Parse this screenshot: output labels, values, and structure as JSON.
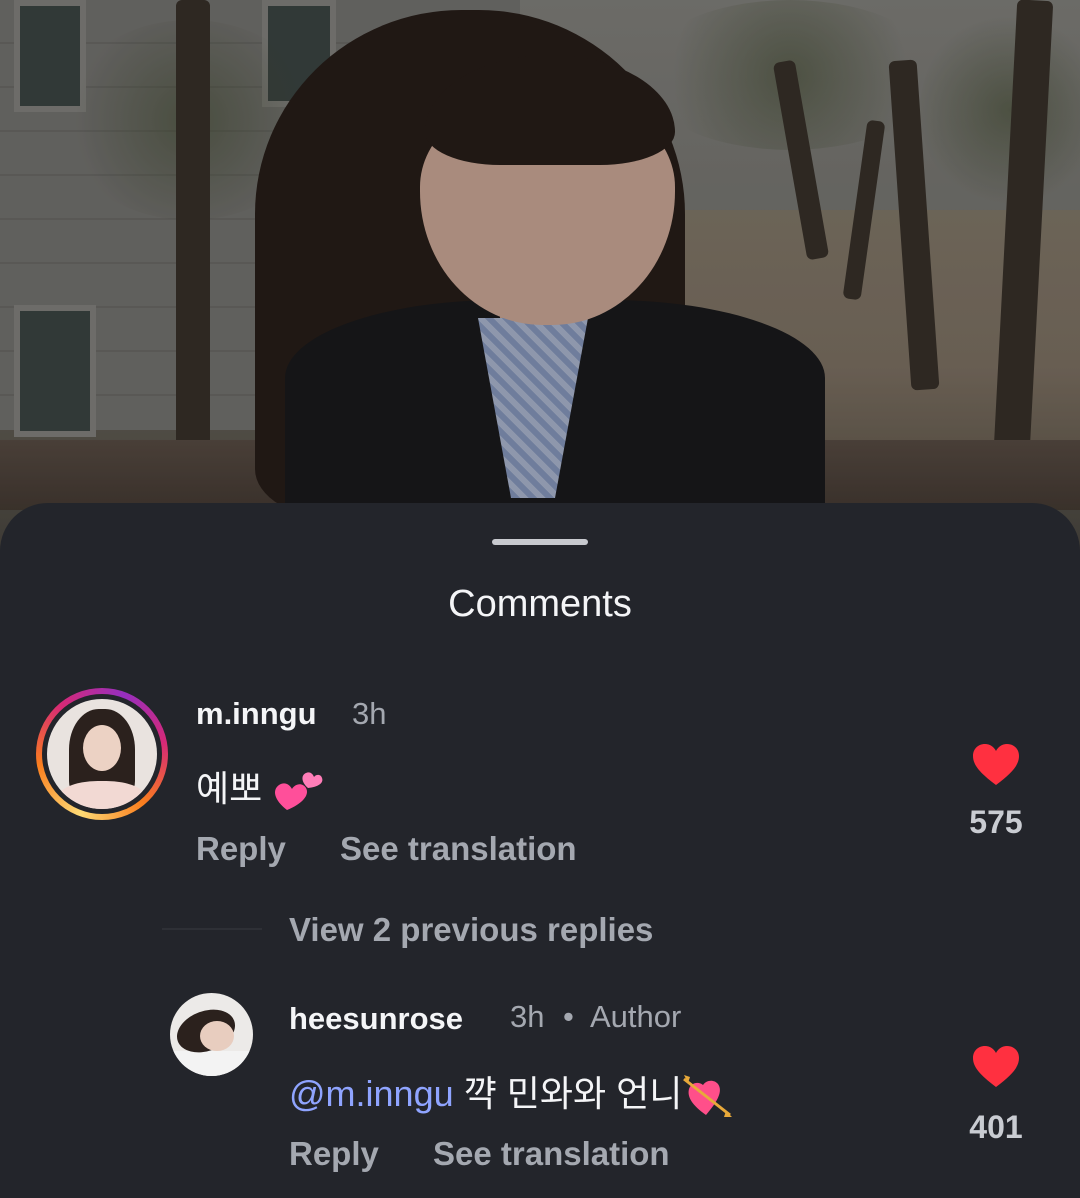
{
  "sheet": {
    "title": "Comments"
  },
  "comments": [
    {
      "username": "m.inngu",
      "time": "3h",
      "text": "예뽀",
      "emoji_name": "two-hearts-emoji",
      "reply_label": "Reply",
      "translate_label": "See translation",
      "likes": "575"
    }
  ],
  "view_replies": "View 2 previous replies",
  "replies": [
    {
      "username": "heesunrose",
      "time": "3h",
      "separator": "•",
      "author_tag": "Author",
      "mention": "@m.inngu",
      "text": "꺅 민와와 언니",
      "emoji_name": "heart-with-arrow-emoji",
      "reply_label": "Reply",
      "translate_label": "See translation",
      "likes": "401"
    }
  ],
  "colors": {
    "background": "#23252b",
    "heart": "#ff3040",
    "mention": "#8fa4ff",
    "secondary_text": "#a4a8b0"
  }
}
